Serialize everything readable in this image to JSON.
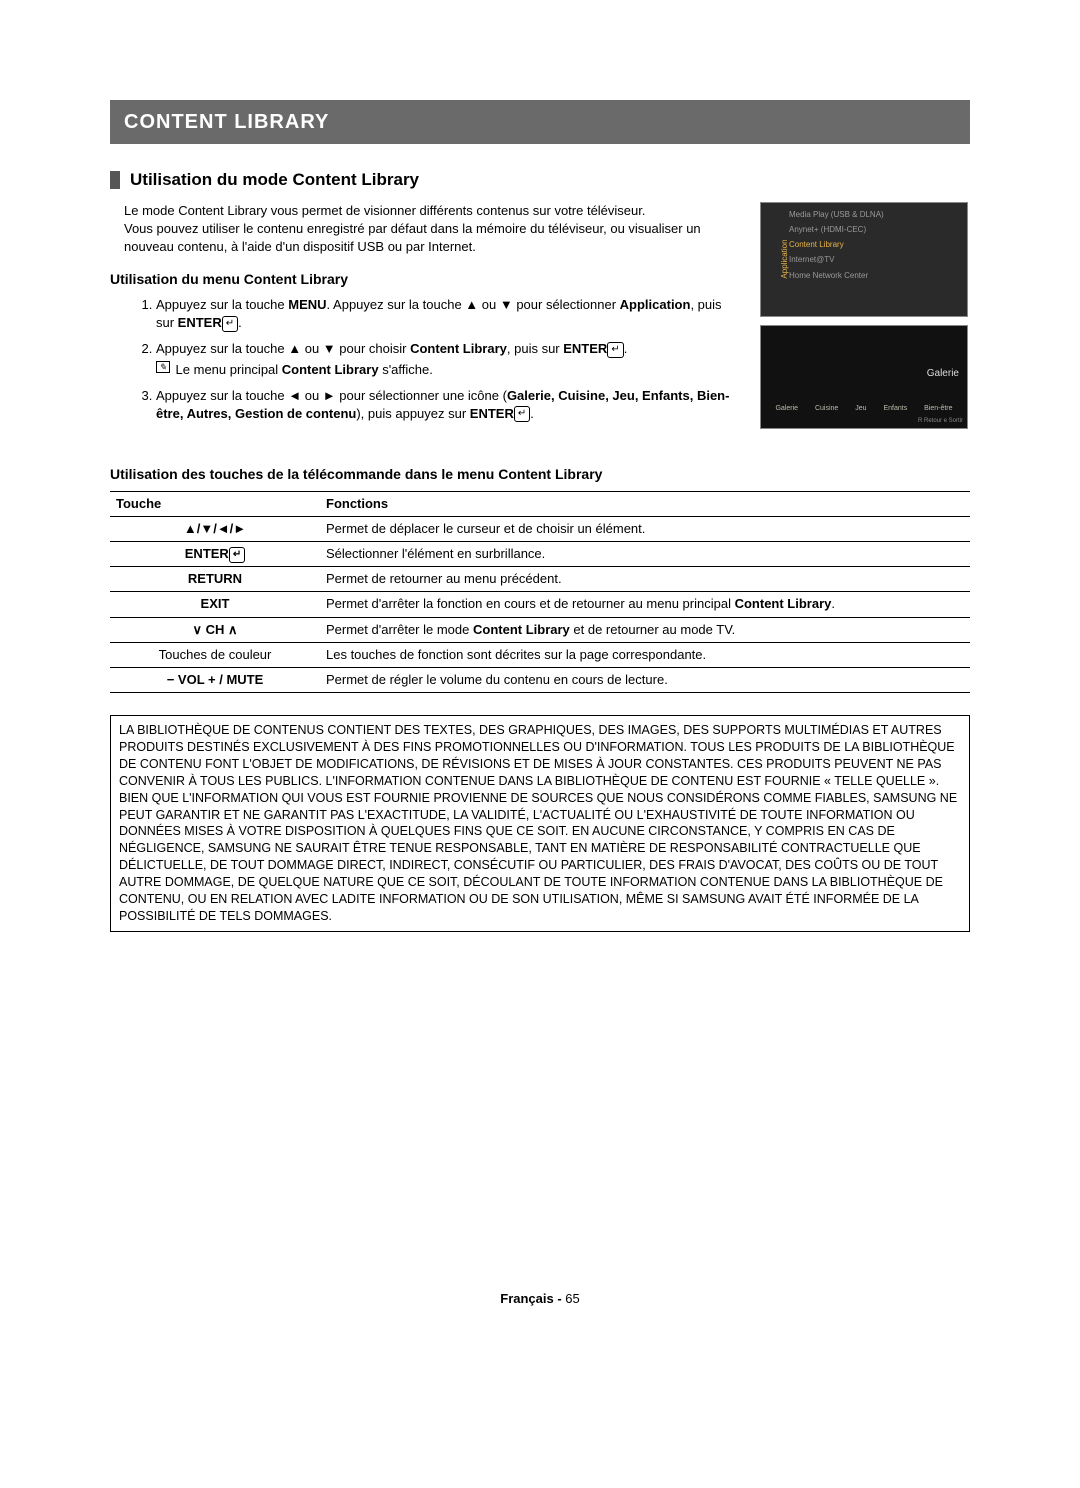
{
  "banner": "CONTENT LIBRARY",
  "section_title": "Utilisation du mode Content Library",
  "intro_line1": "Le mode Content Library vous permet de visionner différents contenus sur votre téléviseur.",
  "intro_line2": "Vous pouvez utiliser le contenu enregistré par défaut dans la mémoire du téléviseur, ou visualiser un nouveau contenu, à l'aide d'un dispositif USB ou par Internet.",
  "sub_heading": "Utilisation du menu Content Library",
  "step1_a": "Appuyez sur la touche ",
  "step1_menu": "MENU",
  "step1_b": ". Appuyez sur la touche ▲ ou ▼ pour sélectionner ",
  "step1_app": "Application",
  "step1_c": ", puis sur ",
  "step1_enter": "ENTER",
  "step2_a": "Appuyez sur la touche ▲ ou ▼ pour choisir ",
  "step2_cl": "Content Library",
  "step2_b": ", puis sur ",
  "step2_enter": "ENTER",
  "step2_note_a": "Le menu principal ",
  "step2_note_b": "Content Library",
  "step2_note_c": " s'affiche.",
  "step3_a": "Appuyez sur la touche ◄ ou ► pour sélectionner une icône (",
  "step3_items": "Galerie, Cuisine, Jeu, Enfants, Bien-être, Autres, Gestion de contenu",
  "step3_b": "), puis appuyez sur ",
  "step3_enter": "ENTER",
  "screen1": {
    "sidebar": "Application",
    "items": {
      "i0": "Media Play (USB & DLNA)",
      "i1": "Anynet+ (HDMI-CEC)",
      "i2": "Content Library",
      "i3": "Internet@TV",
      "i4": "Home Network Center"
    }
  },
  "screen2": {
    "title": "Galerie",
    "thumbs": {
      "t0": "Galerie",
      "t1": "Cuisine",
      "t2": "Jeu",
      "t3": "Enfants",
      "t4": "Bien-être"
    },
    "footer": "R Retour    e Sortir"
  },
  "remote_heading": "Utilisation des touches de la télécommande dans le menu Content Library",
  "table": {
    "h1": "Touche",
    "h2": "Fonctions",
    "rows": {
      "r0": {
        "k": "▲/▼/◄/►",
        "v": "Permet de déplacer le curseur et de choisir un élément."
      },
      "r1": {
        "k": "ENTER",
        "v": "Sélectionner l'élément en surbrillance."
      },
      "r2": {
        "k": "RETURN",
        "v": "Permet de retourner au menu précédent."
      },
      "r3": {
        "k": "EXIT",
        "v_a": "Permet d'arrêter la fonction en cours et de retourner au menu principal ",
        "v_b": "Content Library",
        "v_c": "."
      },
      "r4": {
        "k": "∨ CH ∧",
        "v_a": "Permet d'arrêter le mode ",
        "v_b": "Content Library",
        "v_c": " et de retourner au mode TV."
      },
      "r5": {
        "k": "Touches de couleur",
        "v": "Les touches de fonction sont décrites sur la page correspondante."
      },
      "r6": {
        "k": "− VOL +  / MUTE",
        "v": "Permet de régler le volume du contenu en cours de lecture."
      }
    }
  },
  "disclaimer": "LA BIBLIOTHÈQUE DE CONTENUS CONTIENT DES TEXTES, DES GRAPHIQUES, DES IMAGES, DES SUPPORTS MULTIMÉDIAS ET AUTRES PRODUITS DESTINÉS EXCLUSIVEMENT À DES FINS PROMOTIONNELLES OU D'INFORMATION. TOUS LES PRODUITS DE LA BIBLIOTHÈQUE DE CONTENU FONT L'OBJET DE MODIFICATIONS, DE RÉVISIONS ET DE MISES À JOUR CONSTANTES. CES PRODUITS PEUVENT NE PAS CONVENIR À TOUS LES PUBLICS. L'INFORMATION CONTENUE DANS LA BIBLIOTHÈQUE DE CONTENU EST FOURNIE « TELLE QUELLE ». BIEN QUE L'INFORMATION QUI VOUS EST FOURNIE PROVIENNE DE SOURCES QUE NOUS CONSIDÉRONS COMME FIABLES, SAMSUNG NE PEUT GARANTIR ET NE GARANTIT PAS L'EXACTITUDE, LA VALIDITÉ, L'ACTUALITÉ OU L'EXHAUSTIVITÉ DE TOUTE INFORMATION OU DONNÉES MISES À VOTRE DISPOSITION À QUELQUES FINS QUE CE SOIT. EN AUCUNE CIRCONSTANCE, Y COMPRIS EN CAS DE NÉGLIGENCE, SAMSUNG NE SAURAIT ÊTRE TENUE RESPONSABLE, TANT EN MATIÈRE DE RESPONSABILITÉ CONTRACTUELLE QUE DÉLICTUELLE, DE TOUT DOMMAGE DIRECT, INDIRECT, CONSÉCUTIF OU PARTICULIER, DES FRAIS D'AVOCAT, DES COÛTS OU DE TOUT AUTRE DOMMAGE, DE QUELQUE NATURE QUE CE SOIT, DÉCOULANT DE TOUTE INFORMATION CONTENUE DANS LA BIBLIOTHÈQUE DE CONTENU, OU EN RELATION AVEC LADITE INFORMATION OU DE SON UTILISATION, MÊME SI SAMSUNG AVAIT ÉTÉ INFORMÉE DE LA POSSIBILITÉ DE TELS DOMMAGES.",
  "footer_lang": "Français - ",
  "footer_page": "65",
  "enter_glyph": "↵"
}
